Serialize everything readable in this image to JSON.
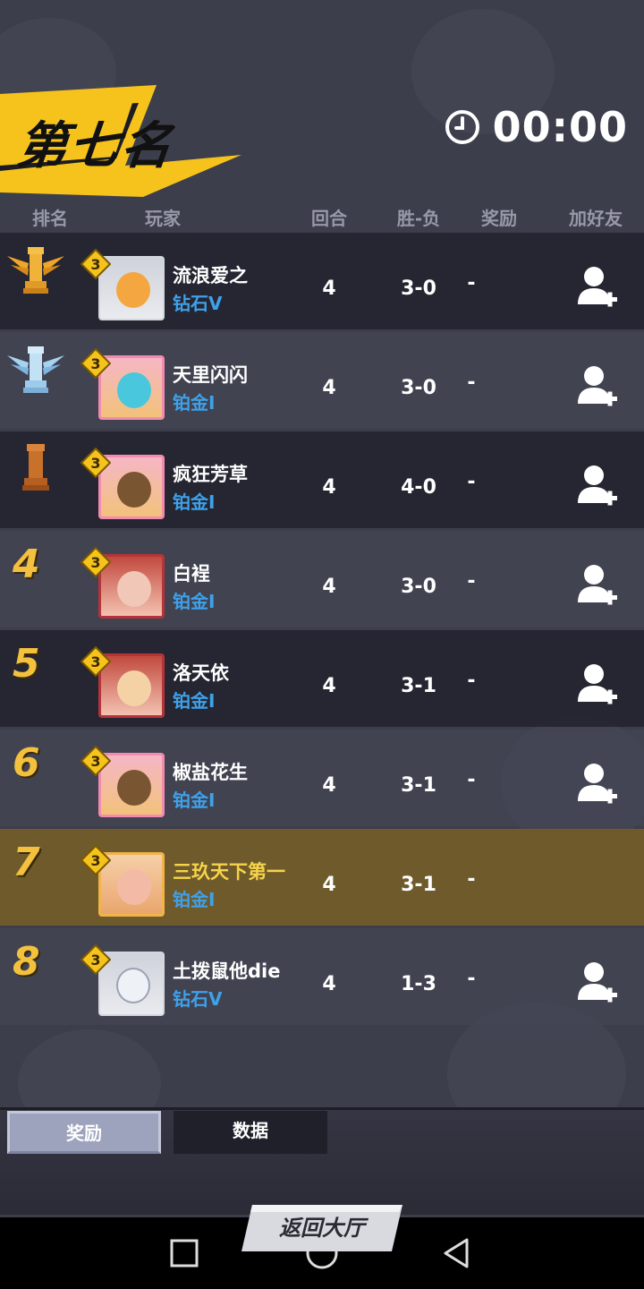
{
  "header": {
    "rank_title": "第七名",
    "timer": "00:00"
  },
  "columns": {
    "rank": "排名",
    "player": "玩家",
    "rounds": "回合",
    "win_loss": "胜-负",
    "reward": "奖励",
    "add_friend": "加好友"
  },
  "rows": [
    {
      "rank": "1",
      "name": "流浪爱之",
      "tier": "钻石V",
      "level": "3",
      "rounds": "4",
      "win_loss": "3-0",
      "reward": "-",
      "add_friend": true
    },
    {
      "rank": "2",
      "name": "天里闪闪",
      "tier": "铂金I",
      "level": "3",
      "rounds": "4",
      "win_loss": "3-0",
      "reward": "-",
      "add_friend": true
    },
    {
      "rank": "3",
      "name": "疯狂芳草",
      "tier": "铂金I",
      "level": "3",
      "rounds": "4",
      "win_loss": "4-0",
      "reward": "-",
      "add_friend": true
    },
    {
      "rank": "4",
      "name": "白裎",
      "tier": "铂金I",
      "level": "3",
      "rounds": "4",
      "win_loss": "3-0",
      "reward": "-",
      "add_friend": true
    },
    {
      "rank": "5",
      "name": "洛天依",
      "tier": "铂金I",
      "level": "3",
      "rounds": "4",
      "win_loss": "3-1",
      "reward": "-",
      "add_friend": true
    },
    {
      "rank": "6",
      "name": "椒盐花生",
      "tier": "铂金I",
      "level": "3",
      "rounds": "4",
      "win_loss": "3-1",
      "reward": "-",
      "add_friend": true
    },
    {
      "rank": "7",
      "name": "三玖天下第一",
      "tier": "铂金I",
      "level": "3",
      "rounds": "4",
      "win_loss": "3-1",
      "reward": "-",
      "add_friend": false
    },
    {
      "rank": "8",
      "name": "土拨鼠他die",
      "tier": "钻石V",
      "level": "3",
      "rounds": "4",
      "win_loss": "1-3",
      "reward": "-",
      "add_friend": true
    }
  ],
  "tabs": {
    "reward": "奖励",
    "data": "数据"
  },
  "return_button": "返回大厅",
  "colors": {
    "rank_gold": "#f3c13d",
    "tier_blue": "#3ea1ea",
    "self_row": "#6f5a2c",
    "self_name": "#f6d34a",
    "banner_yellow": "#f6c31c"
  },
  "icons": {
    "rank1": "gold-winged-chess-rook-icon",
    "rank2": "silver-winged-chess-rook-icon",
    "rank3": "bronze-chess-rook-icon",
    "timer": "clock-icon",
    "add_friend": "add-user-icon",
    "nav": [
      "square-recent-icon",
      "circle-home-icon",
      "triangle-back-icon"
    ]
  }
}
